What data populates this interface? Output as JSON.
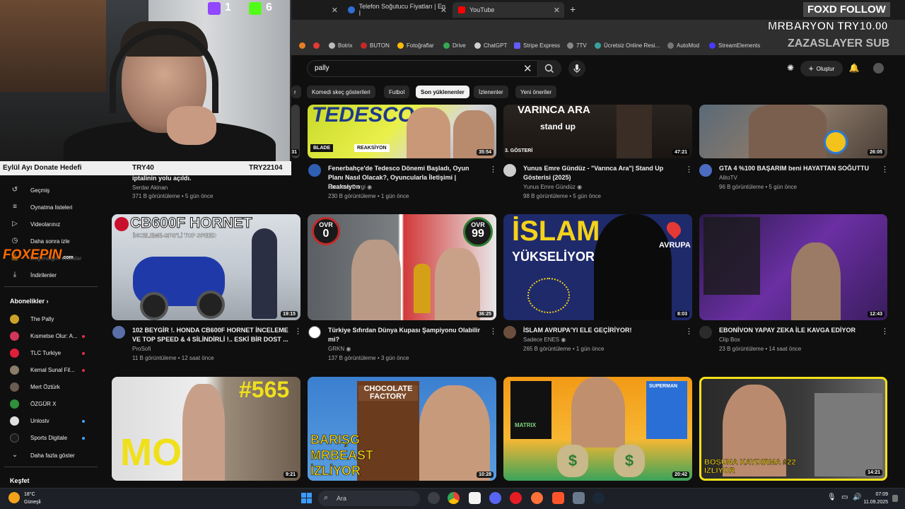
{
  "browser": {
    "tabs": [
      {
        "title": "",
        "active": false
      },
      {
        "title": "Telefon Soğutucu Fiyatları | En İ",
        "active": false
      },
      {
        "title": "YouTube",
        "active": true
      }
    ],
    "bookmarks": [
      "Botrix",
      "BUTON",
      "Fotoğraflar",
      "Drive",
      "ChatGPT",
      "Stripe Express",
      "7TV",
      "Ücretsiz Online Resi...",
      "AutoMod",
      "StreamElements"
    ]
  },
  "youtube": {
    "search": {
      "query": "pally"
    },
    "create_label": "Oluştur",
    "chips": [
      "Komedi skeç gösterileri",
      "Futbol",
      "Son yüklenenler",
      "İzlenenler",
      "Yeni öneriler"
    ],
    "active_chip": "Son yüklenenler"
  },
  "stream": {
    "twitch_count": "1",
    "kick_count": "6",
    "follow_text": "FOXD FOLLOW",
    "donation_text": "MRBARYON TRY10.00",
    "sub_text": "ZAZASLAYER SUB",
    "donate_goal": {
      "title": "Eylül Ayı Donate Hedefi",
      "current": "TRY40",
      "target": "TRY22104"
    },
    "sponsor": "FOXEPIN",
    "sponsor_domain": ".com"
  },
  "sidebar": {
    "items": [
      {
        "label": "Geçmiş",
        "icon": "history-icon"
      },
      {
        "label": "Oynatma listeleri",
        "icon": "playlist-icon"
      },
      {
        "label": "Videolarınız",
        "icon": "video-icon"
      },
      {
        "label": "Daha sonra izle",
        "icon": "clock-icon"
      },
      {
        "label": "Beğendiğim videolar",
        "icon": "like-icon"
      },
      {
        "label": "İndirilenler",
        "icon": "download-icon"
      }
    ],
    "subscriptions_title": "Abonelikler",
    "subscriptions": [
      {
        "label": "The Pally",
        "color": "#c9a227",
        "live": false
      },
      {
        "label": "Kısmetse Olur: A...",
        "color": "#d1365b",
        "live": true
      },
      {
        "label": "TLC Turkiye",
        "color": "#e01f3d",
        "live": true
      },
      {
        "label": "Kemal Sunal Fil...",
        "color": "#8a7d6b",
        "live": true
      },
      {
        "label": "Mert Öztürk",
        "color": "#6b5a4f",
        "live": false
      },
      {
        "label": "ÖZGÜR X",
        "color": "#2f8f3a",
        "live": false
      },
      {
        "label": "Unlostv",
        "color": "#e0e0e0",
        "live": true
      },
      {
        "label": "Sports Digitale",
        "color": "#1b1b1b",
        "live": true
      }
    ],
    "show_more": "Daha fazla göster",
    "explore_title": "Keşfet"
  },
  "videos_row0": [
    {
      "title": "iptalinin yolu açıldı.",
      "channel": "Serdar Akinan",
      "meta": "371 B görüntüleme • 5 gün önce",
      "duration": "31"
    },
    {
      "title": "Fenerbahçe'de Tedesco Dönemi Başladı, Oyun Planı Nasıl Olacak?, Oyuncularla İletişimi | Reaksiyon",
      "channel": "Socrates Dergi",
      "meta": "230 B görüntüleme • 1 gün önce",
      "duration": "35:54",
      "thumb_text": "TEDESCO",
      "thumb_tag1": "BLADE",
      "thumb_tag2": "REAKSİYON"
    },
    {
      "title": "Yunus Emre Gündüz - \"Varınca Ara\"| Stand Up Gösterisi (2025)",
      "channel": "Yunus Emre Gündüz",
      "meta": "98 B görüntüleme • 5 gün önce",
      "duration": "47:21",
      "thumb_text": "VARINCA ARA",
      "thumb_sub": "stand up",
      "thumb_tag": "3. GÖSTERİ"
    },
    {
      "title": "GTA 4 %100 BAŞARIM beni HAYATTAN SOĞUTTU",
      "channel": "AlitoTV",
      "meta": "96 B görüntüleme • 5 gün önce",
      "duration": "26:05"
    }
  ],
  "videos_row1": [
    {
      "title": "102 BEYGİR !. HONDA CB600F HORNET İNCELEME VE TOP SPEED & 4 SİLİNDİRLİ !.. ESKİ BİR DOST ...",
      "channel": "ProSofi",
      "meta": "11 B görüntüleme • 12 saat önce",
      "duration": "19:15",
      "thumb_text": "CB600F HORNET",
      "thumb_sub": "İNCELEME-GPS'Lİ TOP SPEED"
    },
    {
      "title": "Türkiye Sıfırdan Dünya Kupası Şampiyonu Olabilir mi?",
      "channel": "GRKN",
      "meta": "137 B görüntüleme • 3 gün önce",
      "duration": "36:25",
      "ovr_left": "0",
      "ovr_right": "99",
      "ovr_label": "OVR"
    },
    {
      "title": "İSLAM AVRUPA'YI ELE GEÇİRİYOR!",
      "channel": "Sadece ENES",
      "meta": "265 B görüntüleme • 1 gün önce",
      "duration": "8:03",
      "thumb_text": "İSLAM",
      "thumb_sub": "YÜKSELİYOR",
      "thumb_tag": "AVRUPA"
    },
    {
      "title": "EBONİVON YAPAY ZEKA İLE KAVGA EDİYOR",
      "channel": "Clip Box",
      "meta": "23 B görüntüleme • 14 saat önce",
      "duration": "12:43"
    }
  ],
  "videos_row2": [
    {
      "duration": "9:21",
      "thumb_text": "#565",
      "thumb_sub": "MO"
    },
    {
      "duration": "10:28",
      "thumb_text": "BARIŞG MRBEAST İZLİYOR",
      "thumb_sub": "CHOCOLATE FACTORY"
    },
    {
      "duration": "20:42",
      "thumb_text": "MATRIX",
      "thumb_sub": "SUPERMAN"
    },
    {
      "duration": "14:21",
      "thumb_text": "BOŞUNA KAYDIRMA #22 İZLİYOR"
    }
  ],
  "taskbar": {
    "weather_temp": "18°C",
    "weather_desc": "Güneşli",
    "search_placeholder": "Ara",
    "time": "07:09",
    "date": "11.09.2025"
  }
}
